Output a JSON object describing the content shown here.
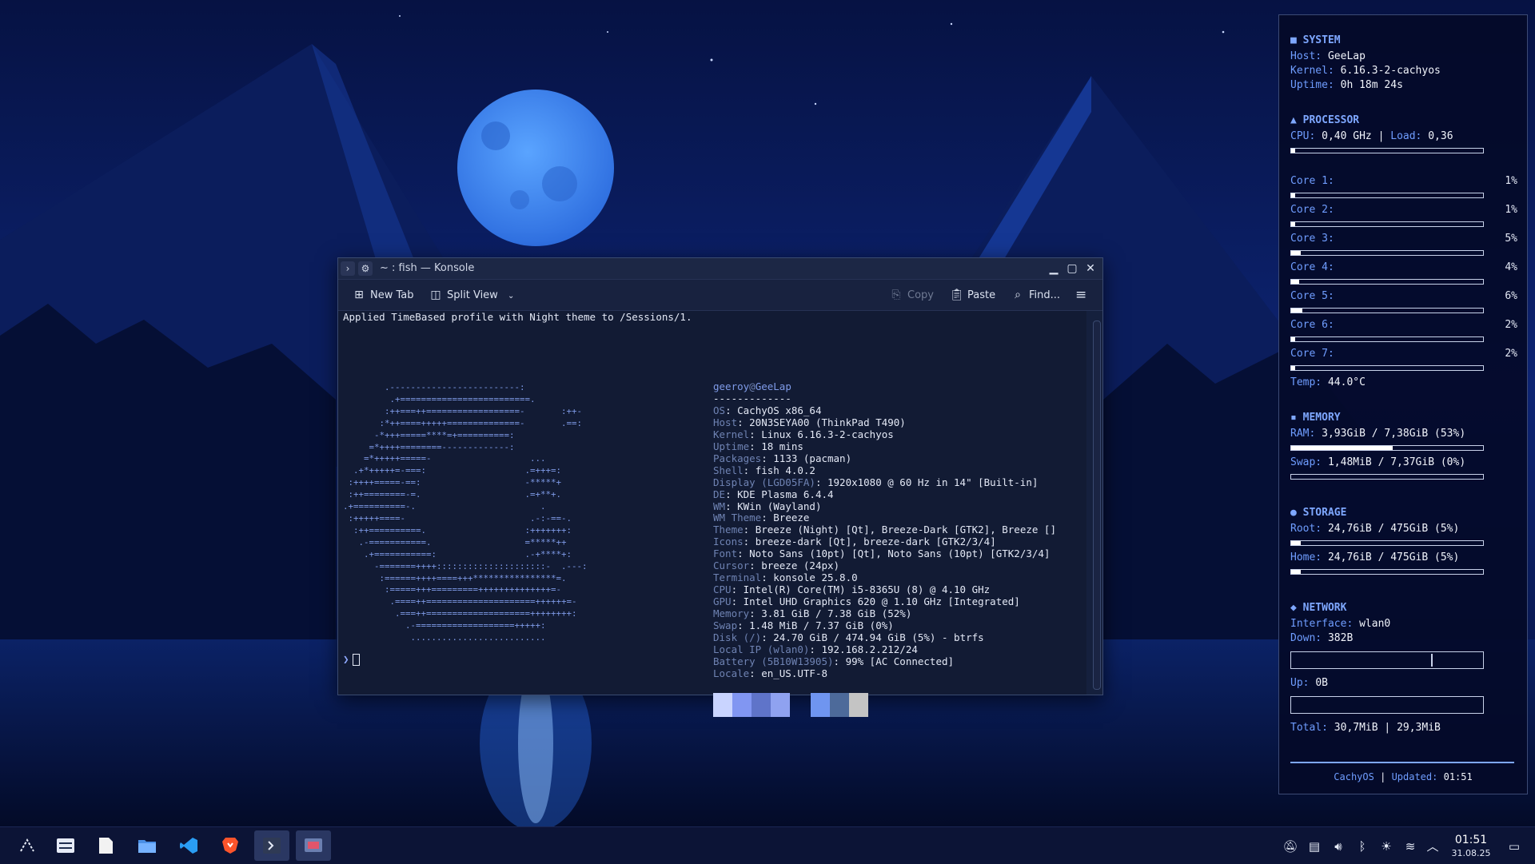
{
  "colors": {
    "desktop_bg": "#07154a",
    "accent": "#7ea7ff",
    "terminal_bg": "#121b34"
  },
  "konsole": {
    "title": "~ : fish — Konsole",
    "toolbar": {
      "new_tab": "New Tab",
      "split_view": "Split View",
      "copy": "Copy",
      "paste": "Paste",
      "find": "Find..."
    },
    "status_line": "Applied TimeBased profile with Night theme to /Sessions/1.",
    "ascii_art": [
      "        .-------------------------:",
      "         .+=========================.",
      "        :++===++==================-       :++-",
      "       :*++====+++++==============-       .==:",
      "      -*+++=====****=+==========:",
      "     =*++++========-------------:",
      "    =*+++++=====-                   ...",
      "  .+*+++++=-===:                   .=+++=:",
      " :++++=====-==:                    -*****+",
      " :++========-=.                    .=+**+.",
      ".+==========-.                        .",
      " :+++++====-                        .-:-==-.",
      "  :++==========.                   :+++++++:",
      "   .-===========.                  =*****++",
      "    .+===========:                 .-+****+:",
      "      -=======++++:::::::::::::::::::::-  .---:",
      "       :======++++====+++****************=.",
      "        :=====+++=========++++++++++++++=-",
      "         .====++=====================++++++=-",
      "          .===++====================++++++++:",
      "            .-===================+++++:",
      "             .........................."
    ],
    "user": "geeroy",
    "host": "GeeLap",
    "separator": "-------------",
    "info": [
      {
        "key": "OS",
        "value": ": CachyOS x86_64"
      },
      {
        "key": "Host",
        "value": ": 20N3SEYA00 (ThinkPad T490)"
      },
      {
        "key": "Kernel",
        "value": ": Linux 6.16.3-2-cachyos"
      },
      {
        "key": "Uptime",
        "value": ": 18 mins"
      },
      {
        "key": "Packages",
        "value": ": 1133 (pacman)"
      },
      {
        "key": "Shell",
        "value": ": fish 4.0.2"
      },
      {
        "key": "Display (LGD05FA)",
        "value": ": 1920x1080 @ 60 Hz in 14\" [Built-in]"
      },
      {
        "key": "DE",
        "value": ": KDE Plasma 6.4.4"
      },
      {
        "key": "WM",
        "value": ": KWin (Wayland)"
      },
      {
        "key": "WM Theme",
        "value": ": Breeze"
      },
      {
        "key": "Theme",
        "value": ": Breeze (Night) [Qt], Breeze-Dark [GTK2], Breeze []"
      },
      {
        "key": "Icons",
        "value": ": breeze-dark [Qt], breeze-dark [GTK2/3/4]"
      },
      {
        "key": "Font",
        "value": ": Noto Sans (10pt) [Qt], Noto Sans (10pt) [GTK2/3/4]"
      },
      {
        "key": "Cursor",
        "value": ": breeze (24px)"
      },
      {
        "key": "Terminal",
        "value": ": konsole 25.8.0"
      },
      {
        "key": "CPU",
        "value": ": Intel(R) Core(TM) i5-8365U (8) @ 4.10 GHz"
      },
      {
        "key": "GPU",
        "value": ": Intel UHD Graphics 620 @ 1.10 GHz [Integrated]"
      },
      {
        "key": "Memory",
        "value": ": 3.81 GiB / 7.38 GiB (52%)"
      },
      {
        "key": "Swap",
        "value": ": 1.48 MiB / 7.37 GiB (0%)"
      },
      {
        "key": "Disk (/)",
        "value": ": 24.70 GiB / 474.94 GiB (5%) - btrfs"
      },
      {
        "key": "Local IP (wlan0)",
        "value": ": 192.168.2.212/24"
      },
      {
        "key": "Battery (5B10W13905)",
        "value": ": 99% [AC Connected]"
      },
      {
        "key": "Locale",
        "value": ": en_US.UTF-8"
      }
    ],
    "palette": [
      "#c9d4ff",
      "#8196f2",
      "#5f74c9",
      "#8fa2f0",
      "#6f95f0",
      "#4d6a9a",
      "#c4c4c4"
    ],
    "prompt": "❯"
  },
  "conky": {
    "system": {
      "head": "SYSTEM",
      "host_label": "Host:",
      "host": "GeeLap",
      "kernel_label": "Kernel:",
      "kernel": "6.16.3-2-cachyos",
      "uptime_label": "Uptime:",
      "uptime": "0h 18m 24s"
    },
    "processor": {
      "head": "PROCESSOR",
      "cpu_label": "CPU:",
      "cpu": "0,40 GHz",
      "sep": "|",
      "load_label": "Load:",
      "load": "0,36",
      "cpu_usage": 0.02,
      "cores": [
        {
          "label": "Core 1:",
          "pct": "1%",
          "usage": 0.01
        },
        {
          "label": "Core 2:",
          "pct": "1%",
          "usage": 0.01
        },
        {
          "label": "Core 3:",
          "pct": "5%",
          "usage": 0.05
        },
        {
          "label": "Core 4:",
          "pct": "4%",
          "usage": 0.04
        },
        {
          "label": "Core 5:",
          "pct": "6%",
          "usage": 0.06
        },
        {
          "label": "Core 6:",
          "pct": "2%",
          "usage": 0.02
        },
        {
          "label": "Core 7:",
          "pct": "2%",
          "usage": 0.02
        }
      ],
      "temp_label": "Temp:",
      "temp": "44.0°C"
    },
    "memory": {
      "head": "MEMORY",
      "ram_label": "RAM:",
      "ram": "3,93GiB / 7,38GiB (53%)",
      "ram_usage": 0.53,
      "swap_label": "Swap:",
      "swap": "1,48MiB / 7,37GiB (0%)",
      "swap_usage": 0.0
    },
    "storage": {
      "head": "STORAGE",
      "root_label": "Root:",
      "root": "24,76iB / 475GiB (5%)",
      "root_usage": 0.05,
      "home_label": "Home:",
      "home": "24,76iB / 475GiB (5%)",
      "home_usage": 0.05
    },
    "network": {
      "head": "NETWORK",
      "iface_label": "Interface:",
      "iface": "wlan0",
      "down_label": "Down:",
      "down": "382B",
      "up_label": "Up:",
      "up": "0B",
      "total_label": "Total:",
      "total": "30,7MiB | 29,3MiB"
    },
    "footer": {
      "os": "CachyOS",
      "sep": "|",
      "updated_label": "Updated:",
      "updated": "01:51"
    }
  },
  "taskbar": {
    "apps": [
      "application-launcher-icon",
      "system-settings-icon",
      "text-editor-icon",
      "file-manager-icon",
      "vscode-icon",
      "brave-browser-icon",
      "konsole-icon",
      "screenshot-tool-icon"
    ],
    "tray": [
      "notifications-muted-icon",
      "clipboard-icon",
      "volume-icon",
      "bluetooth-icon",
      "brightness-icon",
      "wifi-icon",
      "expand-tray-icon"
    ],
    "time": "01:51",
    "date": "31.08.25"
  }
}
